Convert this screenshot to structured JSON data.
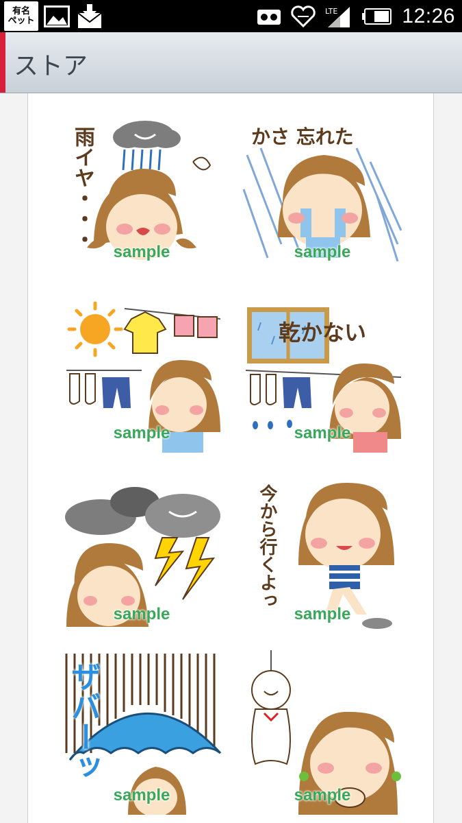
{
  "status_bar": {
    "app_badge_lines": [
      "有名",
      "ペット"
    ],
    "time": "12:26",
    "network": "LTE"
  },
  "app_bar": {
    "title": "ストア",
    "accent_color": "#d8203a"
  },
  "stickers": [
    {
      "caption": "雨イヤ・・・",
      "watermark": "sample",
      "icon": "rain-cloud-girl"
    },
    {
      "caption": "かさ 忘れた",
      "watermark": "sample",
      "icon": "crying-in-rain"
    },
    {
      "caption": "",
      "watermark": "sample",
      "icon": "sunny-laundry"
    },
    {
      "caption": "乾かない",
      "watermark": "sample",
      "icon": "wet-laundry"
    },
    {
      "caption": "",
      "watermark": "sample",
      "icon": "thunder-cloud"
    },
    {
      "caption": "今から行くよっ",
      "watermark": "sample",
      "icon": "running-girl"
    },
    {
      "caption": "ザバーッ",
      "watermark": "sample",
      "icon": "umbrella-downpour"
    },
    {
      "caption": "",
      "watermark": "sample",
      "icon": "teru-teru-bozu"
    }
  ]
}
